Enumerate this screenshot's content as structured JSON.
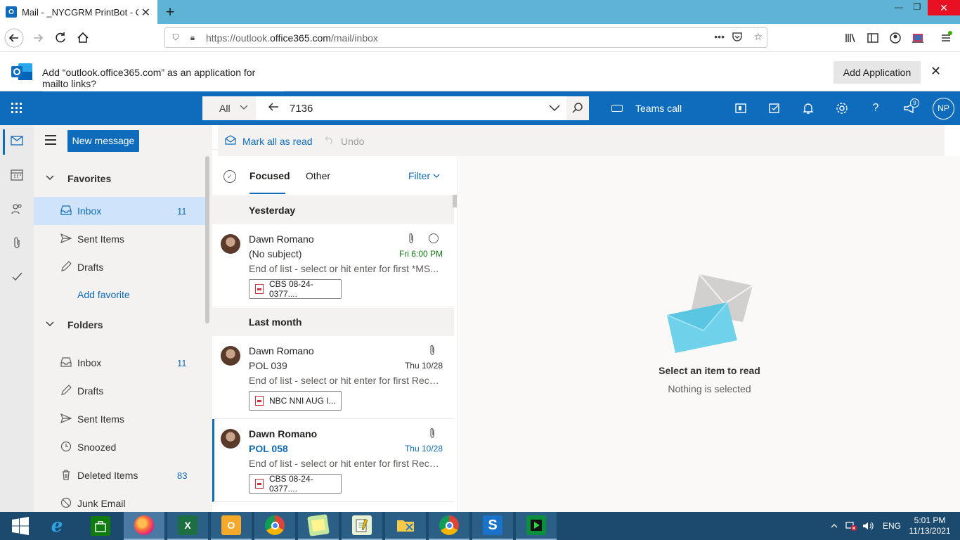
{
  "browser": {
    "tab_title": "Mail - _NYCGRM PrintBot - Out",
    "tab_favicon": "O",
    "url_prefix": "https://outlook.",
    "url_domain": "office365.com",
    "url_path": "/mail/inbox",
    "url_menu_glyph": "•••"
  },
  "notification": {
    "message": "Add “outlook.office365.com” as an application for mailto links?",
    "button_label": "Add Application"
  },
  "header": {
    "search_scope": "All",
    "search_query": "7136",
    "teams_call": "Teams call",
    "notification_count": "9",
    "avatar_initials": "NP",
    "accent": "#0f6cbd"
  },
  "folder_pane": {
    "new_message": "New message",
    "favorites_label": "Favorites",
    "favorites": [
      {
        "label": "Inbox",
        "count": "11",
        "icon": "inbox-icon"
      },
      {
        "label": "Sent Items",
        "count": "",
        "icon": "send-icon"
      },
      {
        "label": "Drafts",
        "count": "",
        "icon": "pencil-icon"
      }
    ],
    "add_favorite": "Add favorite",
    "folders_label": "Folders",
    "folders": [
      {
        "label": "Inbox",
        "count": "11",
        "icon": "inbox-icon"
      },
      {
        "label": "Drafts",
        "count": "",
        "icon": "pencil-icon"
      },
      {
        "label": "Sent Items",
        "count": "",
        "icon": "send-icon"
      },
      {
        "label": "Snoozed",
        "count": "",
        "icon": "clock-icon"
      },
      {
        "label": "Deleted Items",
        "count": "83",
        "icon": "trash-icon"
      },
      {
        "label": "Junk Email",
        "count": "",
        "icon": "block-icon"
      }
    ]
  },
  "command_bar": {
    "mark_all_read": "Mark all as read",
    "undo": "Undo"
  },
  "message_list": {
    "tab_focused": "Focused",
    "tab_other": "Other",
    "filter": "Filter",
    "groups": [
      {
        "label": "Yesterday",
        "messages": [
          {
            "from": "Dawn Romano",
            "subject": "(No subject)",
            "date": "Fri 6:00 PM",
            "preview": "End of list - select or hit enter for first *MS...",
            "attachment": "CBS 08-24-0377...."
          }
        ]
      },
      {
        "label": "Last month",
        "messages": [
          {
            "from": "Dawn Romano",
            "subject": "POL 039",
            "date": "Thu 10/28",
            "preview": "End of list - select or hit enter for first Reco...",
            "attachment": "NBC NNI AUG I..."
          },
          {
            "from": "Dawn Romano",
            "subject": "POL 058",
            "date": "Thu 10/28",
            "preview": "End of list - select or hit enter for first Reco...",
            "attachment": "CBS 08-24-0377...."
          }
        ]
      }
    ]
  },
  "reading_pane": {
    "title": "Select an item to read",
    "subtitle": "Nothing is selected"
  },
  "taskbar": {
    "language": "ENG",
    "time": "5:01 PM",
    "date": "11/13/2021",
    "apps": [
      "internet-explorer",
      "store",
      "firefox",
      "excel",
      "outlook",
      "chrome",
      "sticky-notes",
      "notepad-plus",
      "file-explorer",
      "chrome-d",
      "swift",
      "player"
    ]
  }
}
